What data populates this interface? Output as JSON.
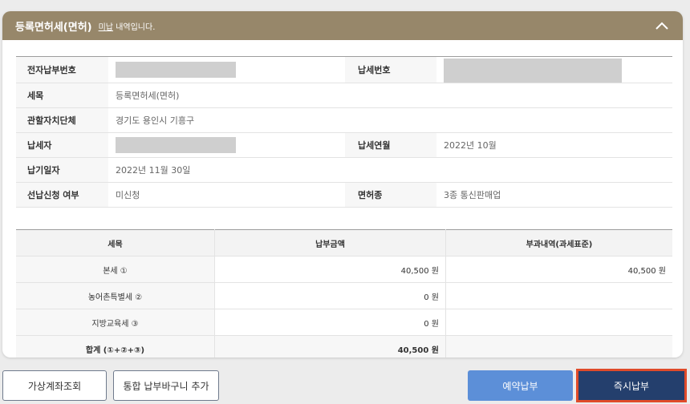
{
  "header": {
    "title": "등록면허세(면허)",
    "sub_underline": "미납",
    "sub_rest": " 내역입니다."
  },
  "info": {
    "electronic_no_label": "전자납부번호",
    "tax_no_label": "납세번호",
    "tax_item_label": "세목",
    "tax_item_value": "등록면허세(면허)",
    "authority_label": "관할자치단체",
    "authority_value": "경기도 용인시 기흥구",
    "taxpayer_label": "납세자",
    "tax_month_label": "납세연월",
    "tax_month_value": "2022년 10월",
    "due_label": "납기일자",
    "due_value": "2022년 11월 30일",
    "prepay_label": "선납신청 여부",
    "prepay_value": "미신청",
    "license_label": "면허종",
    "license_value": "3종 통신판매업"
  },
  "amounts": {
    "headers": [
      "세목",
      "납부금액",
      "부과내역(과세표준)"
    ],
    "rows": [
      {
        "item": "본세 ①",
        "amount": "40,500 원",
        "basis": "40,500 원"
      },
      {
        "item": "농어촌특별세 ②",
        "amount": "0 원",
        "basis": ""
      },
      {
        "item": "지방교육세 ③",
        "amount": "0 원",
        "basis": ""
      },
      {
        "item": "합계 (①+②+③)",
        "amount": "40,500 원",
        "basis": ""
      }
    ]
  },
  "buttons": {
    "virtual_account": "가상계좌조회",
    "add_cart": "통합 납부바구니 추가",
    "reserve_pay": "예약납부",
    "instant_pay": "즉시납부"
  },
  "colors": {
    "header_bg": "#97876a",
    "reserve_btn": "#5c8fd8",
    "instant_btn": "#243f6d",
    "highlight": "#e04b2a"
  },
  "icons": {
    "collapse": "chevron-up-icon"
  }
}
